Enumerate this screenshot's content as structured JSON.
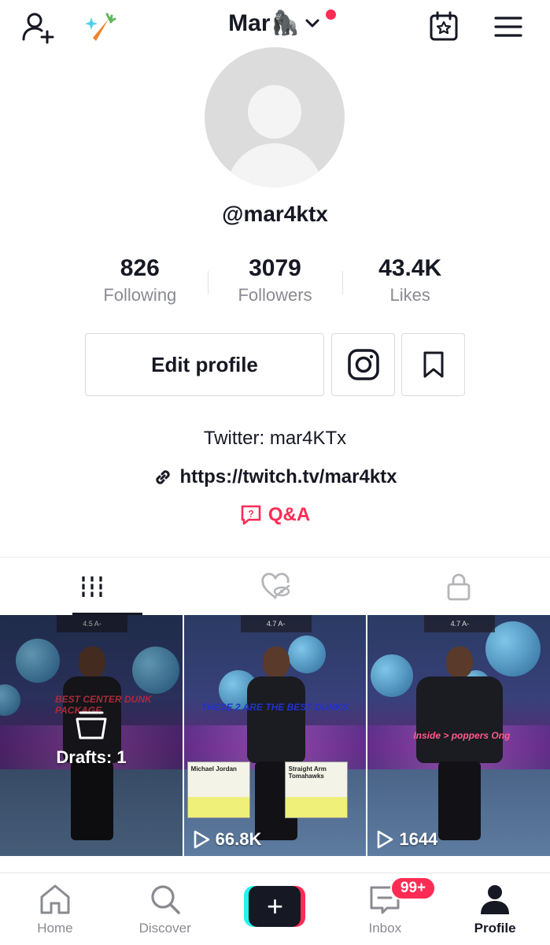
{
  "header": {
    "title": "Mar🦍",
    "icons": [
      "add-friend-icon",
      "carrot-icon",
      "chevron-down-icon",
      "calendar-star-icon",
      "menu-icon"
    ]
  },
  "profile": {
    "handle": "@mar4ktx",
    "stats": [
      {
        "value": "826",
        "label": "Following"
      },
      {
        "value": "3079",
        "label": "Followers"
      },
      {
        "value": "43.4K",
        "label": "Likes"
      }
    ],
    "edit_label": "Edit profile",
    "bio": "Twitter: mar4KTx",
    "link": "https://twitch.tv/mar4ktx",
    "qa": "Q&A"
  },
  "tabs": [
    {
      "icon": "videos-grid-icon",
      "active": true
    },
    {
      "icon": "liked-hidden-icon",
      "active": false
    },
    {
      "icon": "lock-icon",
      "active": false
    }
  ],
  "grid": [
    {
      "type": "drafts",
      "label": "Drafts: 1",
      "overlay_text": "BEST CENTER DUNK PACKAGE",
      "hud": "4.5 A-"
    },
    {
      "type": "video",
      "views": "66.8K",
      "overlay_text": "THESE 2 ARE THE BEST DUNKS",
      "hud": "4.7 A-",
      "cards": [
        "Michael Jordan",
        "Straight Arm Tomahawks"
      ]
    },
    {
      "type": "video",
      "views": "1644",
      "overlay_text": "Inside > poppers Ong",
      "hud": "4.7 A-"
    }
  ],
  "nav": {
    "items": [
      {
        "label": "Home",
        "icon": "home-icon"
      },
      {
        "label": "Discover",
        "icon": "search-icon"
      },
      {
        "label": "",
        "icon": "plus-icon"
      },
      {
        "label": "Inbox",
        "icon": "inbox-icon"
      },
      {
        "label": "Profile",
        "icon": "profile-icon"
      }
    ],
    "inbox_badge": "99+"
  },
  "colors": {
    "accent": "#fe2c55",
    "cyan": "#25f4ee",
    "text": "#161823",
    "muted": "#8a8b91"
  }
}
